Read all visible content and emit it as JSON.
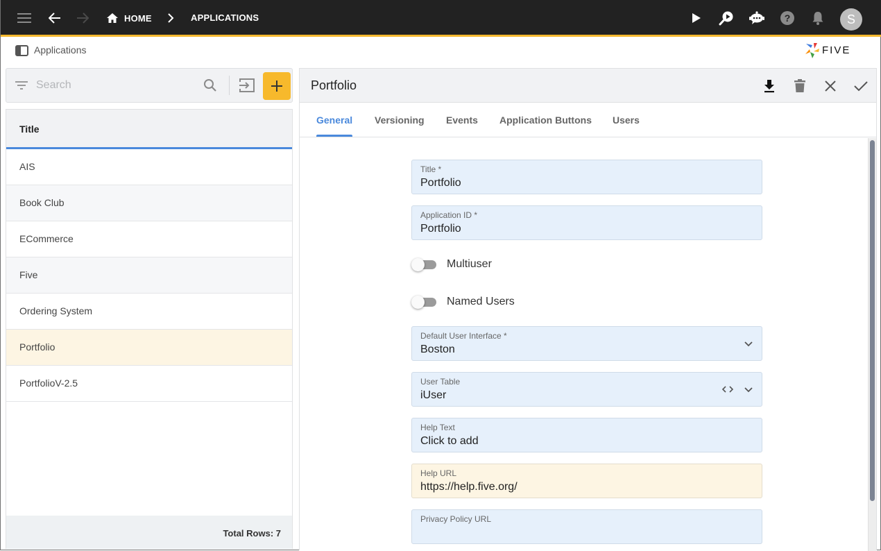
{
  "topbar": {
    "breadcrumbs": [
      {
        "label": "HOME",
        "icon": "home-icon"
      },
      {
        "label": "APPLICATIONS"
      }
    ],
    "icons": [
      "menu-icon",
      "back-arrow-icon",
      "forward-arrow-icon",
      "play-icon",
      "search-play-icon",
      "chat-bot-icon",
      "help-icon",
      "bell-icon"
    ],
    "avatar_initial": "S",
    "accent_color": "#f5b82e"
  },
  "subheader": {
    "title": "Applications",
    "logo_text": "FIVE"
  },
  "list_panel": {
    "search_placeholder": "Search",
    "search_value": "",
    "column_header": "Title",
    "rows": [
      {
        "title": "AIS"
      },
      {
        "title": "Book Club"
      },
      {
        "title": "ECommerce"
      },
      {
        "title": "Five"
      },
      {
        "title": "Ordering System"
      },
      {
        "title": "Portfolio",
        "selected": true
      },
      {
        "title": "PortfolioV-2.5"
      }
    ],
    "footer": "Total Rows: 7"
  },
  "detail": {
    "title": "Portfolio",
    "tabs": [
      {
        "label": "General",
        "active": true
      },
      {
        "label": "Versioning"
      },
      {
        "label": "Events"
      },
      {
        "label": "Application Buttons"
      },
      {
        "label": "Users"
      }
    ],
    "fields": {
      "title": {
        "label": "Title *",
        "value": "Portfolio"
      },
      "application_id": {
        "label": "Application ID *",
        "value": "Portfolio"
      },
      "multiuser": {
        "label": "Multiuser",
        "checked": false
      },
      "named_users": {
        "label": "Named Users",
        "checked": false
      },
      "default_ui": {
        "label": "Default User Interface *",
        "value": "Boston"
      },
      "user_table": {
        "label": "User Table",
        "value": "iUser"
      },
      "help_text": {
        "label": "Help Text",
        "value": "Click to add"
      },
      "help_url": {
        "label": "Help URL",
        "value": "https://help.five.org/"
      },
      "privacy_url": {
        "label": "Privacy Policy URL",
        "value": ""
      }
    }
  }
}
